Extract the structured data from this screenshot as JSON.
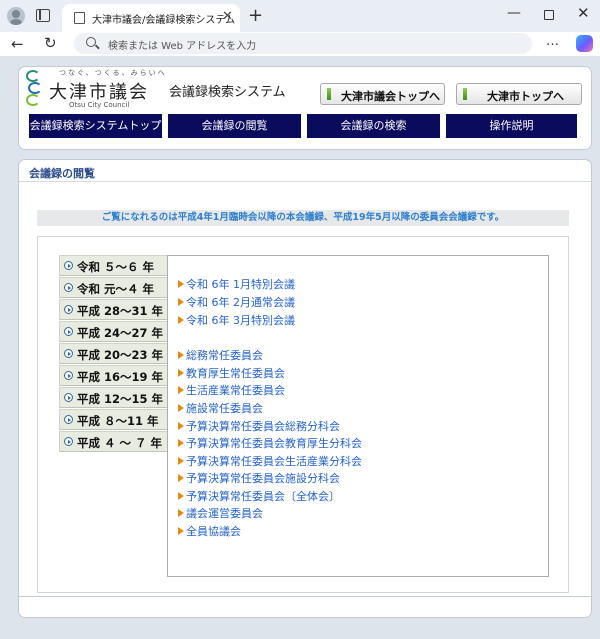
{
  "browser": {
    "tab_title": "大津市議会/会議録検索システム",
    "address_placeholder": "検索または Web アドレスを入力",
    "tab_close": "✕",
    "new_tab": "+",
    "minimize": "—",
    "close": "✕",
    "back": "←",
    "reload": "↻",
    "more": "…"
  },
  "header": {
    "tagline": "つなぐ、つくる、みらいへ",
    "site_name": "大津市議会",
    "site_name_en": "Otsu City Council",
    "system_name": "会議録検索システム",
    "council_top_label": "大津市議会トップへ",
    "city_top_label": "大津市トップへ"
  },
  "nav": {
    "items": [
      {
        "label": "会議録検索システムトップ"
      },
      {
        "label": "会議録の閲覧"
      },
      {
        "label": "会議録の検索"
      },
      {
        "label": "操作説明"
      }
    ]
  },
  "content": {
    "title": "会議録の閲覧",
    "notice": "ご覧になれるのは平成4年1月臨時会以降の本会議録、平成19年5月以降の委員会会議録です。",
    "eras": [
      {
        "label": "令和 ５～６ 年"
      },
      {
        "label": "令和 元～４ 年"
      },
      {
        "label": "平成 28～31 年"
      },
      {
        "label": "平成 24～27 年"
      },
      {
        "label": "平成 20～23 年"
      },
      {
        "label": "平成 16～19 年"
      },
      {
        "label": "平成 12～15 年"
      },
      {
        "label": "平成 ８～11 年"
      },
      {
        "label": "平成 ４ ～ ７ 年"
      }
    ],
    "plenary": [
      {
        "label": "令和 6年 1月特別会議"
      },
      {
        "label": "令和 6年 2月通常会議"
      },
      {
        "label": "令和 6年 3月特別会議"
      }
    ],
    "committees": [
      {
        "label": "総務常任委員会"
      },
      {
        "label": "教育厚生常任委員会"
      },
      {
        "label": "生活産業常任委員会"
      },
      {
        "label": "施設常任委員会"
      },
      {
        "label": "予算決算常任委員会総務分科会"
      },
      {
        "label": "予算決算常任委員会教育厚生分科会"
      },
      {
        "label": "予算決算常任委員会生活産業分科会"
      },
      {
        "label": "予算決算常任委員会施設分科会"
      },
      {
        "label": "予算決算常任委員会〔全体会〕"
      },
      {
        "label": "議会運営委員会"
      },
      {
        "label": "全員協議会"
      }
    ]
  }
}
